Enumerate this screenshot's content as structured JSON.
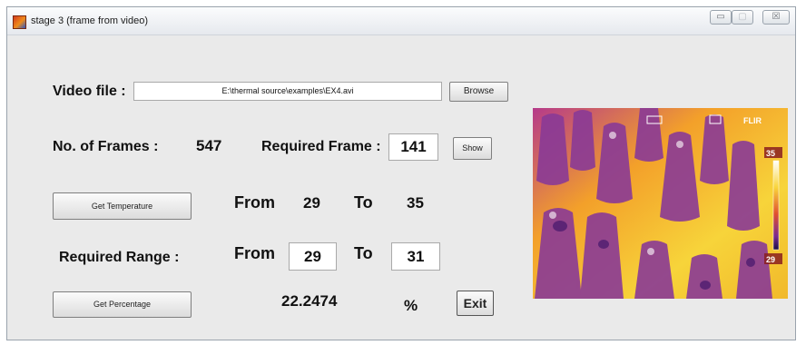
{
  "window": {
    "title": "stage 3 (frame from video)"
  },
  "titlebar_buttons": {
    "minimize": "▭",
    "maximize": "▢",
    "close": "☒"
  },
  "video": {
    "label": "Video file :",
    "path": "E:\\thermal source\\examples\\EX4.avi",
    "browse_label": "Browse"
  },
  "frames": {
    "label": "No. of Frames :",
    "count": "547",
    "required_label": "Required Frame :",
    "required_value": "141",
    "show_label": "Show"
  },
  "temperature": {
    "button_label": "Get Temperature",
    "from_label": "From",
    "from_value": "29",
    "to_label": "To",
    "to_value": "35"
  },
  "range": {
    "label": "Required Range :",
    "from_label": "From",
    "from_value": "29",
    "to_label": "To",
    "to_value": "31"
  },
  "percentage": {
    "button_label": "Get Percentage",
    "value": "22.2474",
    "unit": "%",
    "exit_label": "Exit"
  },
  "thermal_image": {
    "brand": "FLIR",
    "scale_max": "35",
    "scale_min": "29"
  }
}
